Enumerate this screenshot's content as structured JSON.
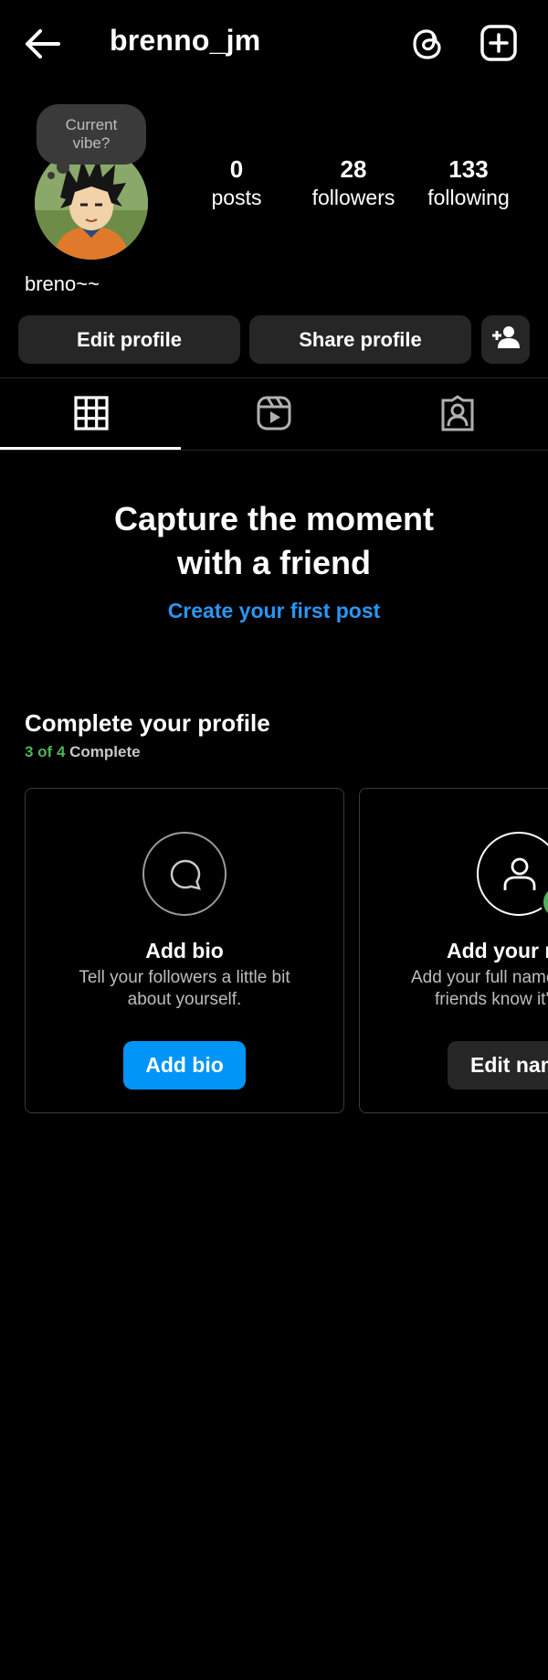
{
  "header": {
    "username": "brenno_jm",
    "back_icon": "arrow-left-icon",
    "threads_icon": "threads-icon",
    "add_icon": "plus-square-icon"
  },
  "profile": {
    "vibe_prompt": "Current vibe?",
    "display_name": "breno~~",
    "stats": [
      {
        "value": "0",
        "label": "posts"
      },
      {
        "value": "28",
        "label": "followers"
      },
      {
        "value": "133",
        "label": "following"
      }
    ]
  },
  "actions": {
    "edit_label": "Edit profile",
    "share_label": "Share profile",
    "discover_icon": "add-person-icon"
  },
  "tabs": [
    {
      "name": "grid",
      "icon": "grid-icon",
      "selected": true
    },
    {
      "name": "reels",
      "icon": "reels-icon",
      "selected": false
    },
    {
      "name": "tagged",
      "icon": "tagged-person-icon",
      "selected": false
    }
  ],
  "empty_state": {
    "title_line1": "Capture the moment",
    "title_line2": "with a friend",
    "link": "Create your first post"
  },
  "complete_profile": {
    "title": "Complete your profile",
    "progress_done": "3 of 4",
    "progress_suffix": " Complete",
    "cards": [
      {
        "title": "Add bio",
        "desc_line1": "Tell your followers a little bit",
        "desc_line2": "about yourself.",
        "button": "Add bio",
        "icon": "speech-bubble-icon"
      },
      {
        "title": "Add your name",
        "desc_line1": "Add your full name so your",
        "desc_line2": "friends know it's you.",
        "button": "Edit name",
        "icon": "person-icon"
      }
    ]
  },
  "colors": {
    "background": "#000000",
    "button": "#262626",
    "link_blue": "#2a96f3",
    "primary_blue": "#0095f6",
    "progress_green": "#4fb35a"
  }
}
